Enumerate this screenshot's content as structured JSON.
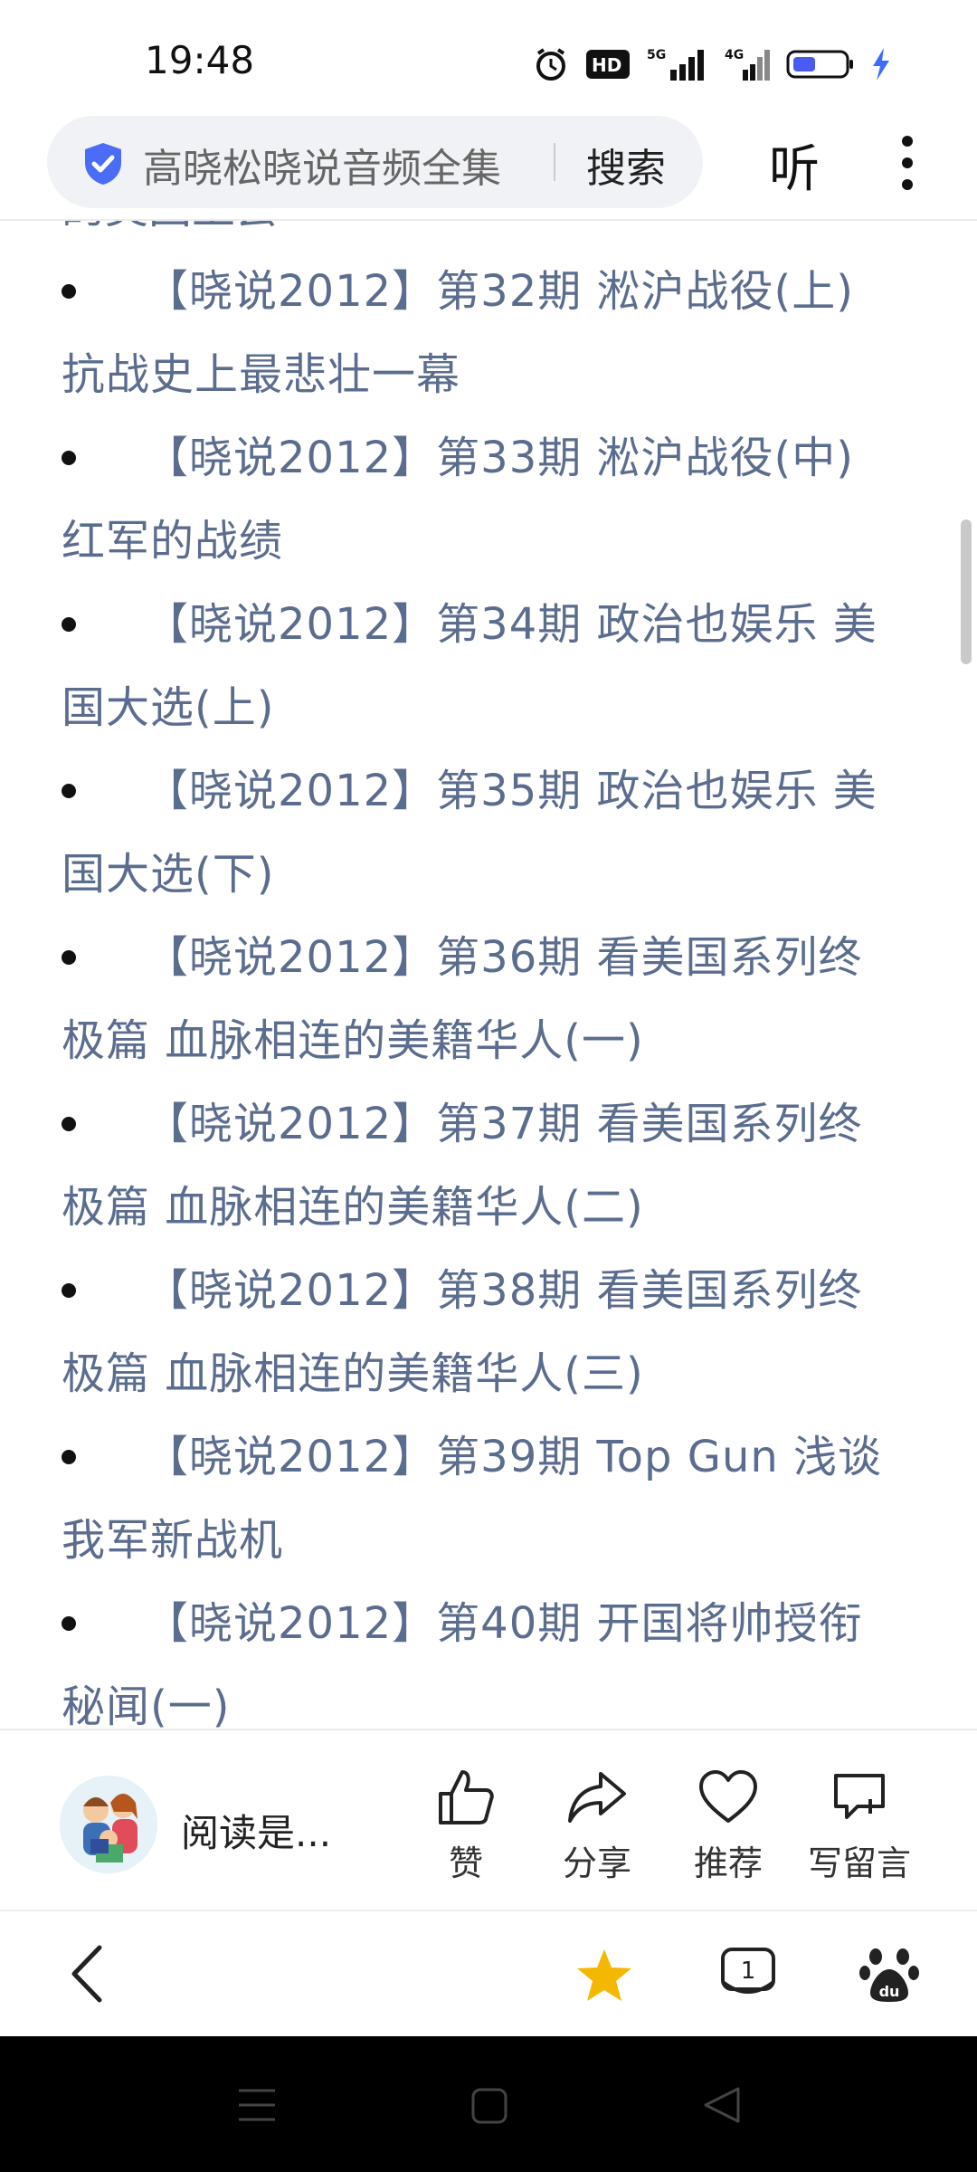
{
  "status_bar": {
    "time": "19:48",
    "icons": [
      "alarm-icon",
      "hd-icon",
      "5g-signal-icon",
      "4g-signal-icon",
      "battery-icon",
      "charging-icon"
    ]
  },
  "header": {
    "search_query": "高晓松晓说音频全集",
    "search_button": "搜索",
    "listen_button": "听"
  },
  "article": {
    "cut_text_top": "的美国上尝",
    "items": [
      {
        "text": "【晓说2012】第32期 淞沪战役(上) 抗战史上最悲壮一幕"
      },
      {
        "text": "【晓说2012】第33期 淞沪战役(中) 红军的战绩"
      },
      {
        "text": "【晓说2012】第34期 政治也娱乐 美国大选(上)"
      },
      {
        "text": "【晓说2012】第35期 政治也娱乐 美国大选(下)"
      },
      {
        "text": "【晓说2012】第36期 看美国系列终极篇 血脉相连的美籍华人(一)"
      },
      {
        "text": "【晓说2012】第37期 看美国系列终极篇 血脉相连的美籍华人(二)"
      },
      {
        "text": "【晓说2012】第38期 看美国系列终极篇 血脉相连的美籍华人(三)"
      },
      {
        "text": "【晓说2012】第39期 Top Gun 浅谈我军新战机"
      },
      {
        "text": "【晓说2012】第40期 开国将帅授衔秘闻(一)"
      }
    ]
  },
  "action_bar": {
    "author": "阅读是...",
    "like": "赞",
    "share": "分享",
    "recommend": "推荐",
    "comment": "写留言"
  },
  "bottom_nav": {
    "tab_count": "1"
  },
  "colors": {
    "link": "#5b6d8f",
    "star": "#f5b800",
    "shield": "#4a6cf7"
  }
}
